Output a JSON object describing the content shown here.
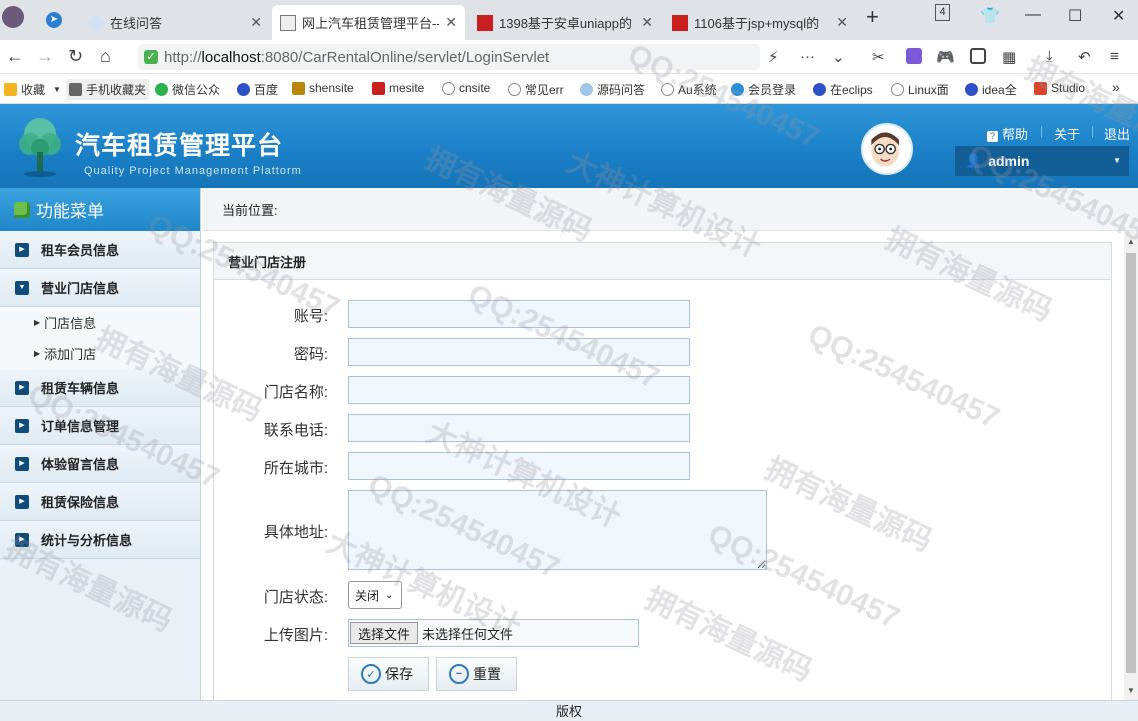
{
  "browser": {
    "tabs": [
      {
        "title": "在线问答",
        "active": false
      },
      {
        "title": "网上汽车租赁管理平台--",
        "active": true
      },
      {
        "title": "1398基于安卓uniapp的",
        "active": false
      },
      {
        "title": "1106基于jsp+mysql的",
        "active": false
      }
    ],
    "tab_count_badge": "4",
    "url_prefix": "http://",
    "url_host": "localhost",
    "url_rest": ":8080/CarRentalOnline/servlet/LoginServlet",
    "bookmarks": [
      "收藏",
      "手机收藏夹",
      "微信公众",
      "百度",
      "shensite",
      "mesite",
      "cnsite",
      "常见err",
      "源码问答",
      "Au系统",
      "会员登录",
      "在eclips",
      "Linux面",
      "idea全",
      "Studio"
    ]
  },
  "header": {
    "title": "汽车租赁管理平台",
    "subtitle": "Quality Project Management Plattorm",
    "links": [
      "帮助",
      "关于",
      "退出"
    ],
    "user": "admin"
  },
  "sidebar": {
    "title": "功能菜单",
    "items": [
      {
        "label": "租车会员信息"
      },
      {
        "label": "营业门店信息",
        "children": [
          "门店信息",
          "添加门店"
        ]
      },
      {
        "label": "租赁车辆信息"
      },
      {
        "label": "订单信息管理"
      },
      {
        "label": "体验留言信息"
      },
      {
        "label": "租赁保险信息"
      },
      {
        "label": "统计与分析信息"
      }
    ]
  },
  "breadcrumb": "当前位置:",
  "form": {
    "title": "营业门店注册",
    "fields": {
      "account": {
        "label": "账号:",
        "value": ""
      },
      "password": {
        "label": "密码:",
        "value": ""
      },
      "store_name": {
        "label": "门店名称:",
        "value": ""
      },
      "phone": {
        "label": "联系电话:",
        "value": ""
      },
      "city": {
        "label": "所在城市:",
        "value": ""
      },
      "address": {
        "label": "具体地址:",
        "value": ""
      },
      "status": {
        "label": "门店状态:",
        "value": "关闭"
      },
      "upload": {
        "label": "上传图片:",
        "button": "选择文件",
        "file_text": "未选择任何文件"
      }
    },
    "save_label": "保存",
    "reset_label": "重置"
  },
  "footer": "版权",
  "watermarks": [
    "QQ:254540457",
    "大神计算机设计",
    "拥有海量源码"
  ]
}
